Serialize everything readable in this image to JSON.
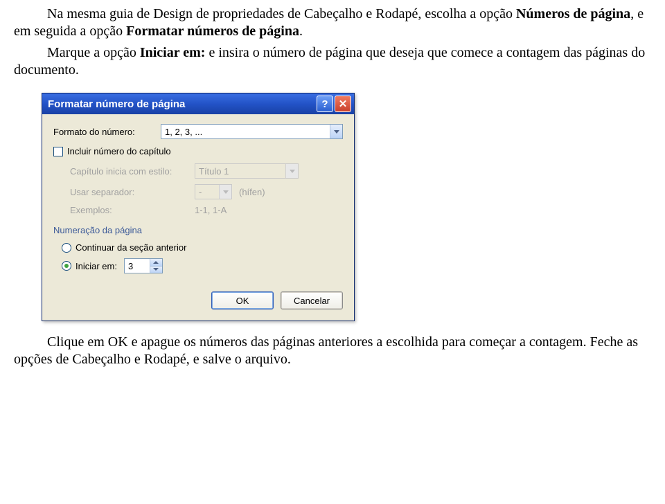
{
  "doc": {
    "p1_a": "Na mesma guia de Design de propriedades de Cabeçalho e Rodapé, escolha a opção ",
    "p1_b": "Números de página",
    "p1_c": ", e em seguida a opção ",
    "p1_d": "Formatar números de página",
    "p1_e": ".",
    "p2_a": "Marque a opção ",
    "p2_b": "Iniciar em:",
    "p2_c": " e insira o número de página que deseja que comece a contagem das páginas do documento.",
    "p3": "Clique em OK e apague os números das páginas anteriores a escolhida para começar a contagem. Feche as opções de Cabeçalho e Rodapé, e salve o arquivo."
  },
  "dialog": {
    "title": "Formatar número de página",
    "format_label": "Formato do número:",
    "format_value": "1, 2, 3, ...",
    "include_chapter": "Incluir número do capítulo",
    "chapter_style_label": "Capítulo inicia com estilo:",
    "chapter_style_value": "Título 1",
    "separator_label": "Usar separador:",
    "separator_value": "-",
    "separator_hint": "(hífen)",
    "examples_label": "Exemplos:",
    "examples_value": "1-1, 1-A",
    "section_title": "Numeração da página",
    "radio_continue": "Continuar da seção anterior",
    "radio_start": "Iniciar em:",
    "start_value": "3",
    "ok": "OK",
    "cancel": "Cancelar"
  }
}
